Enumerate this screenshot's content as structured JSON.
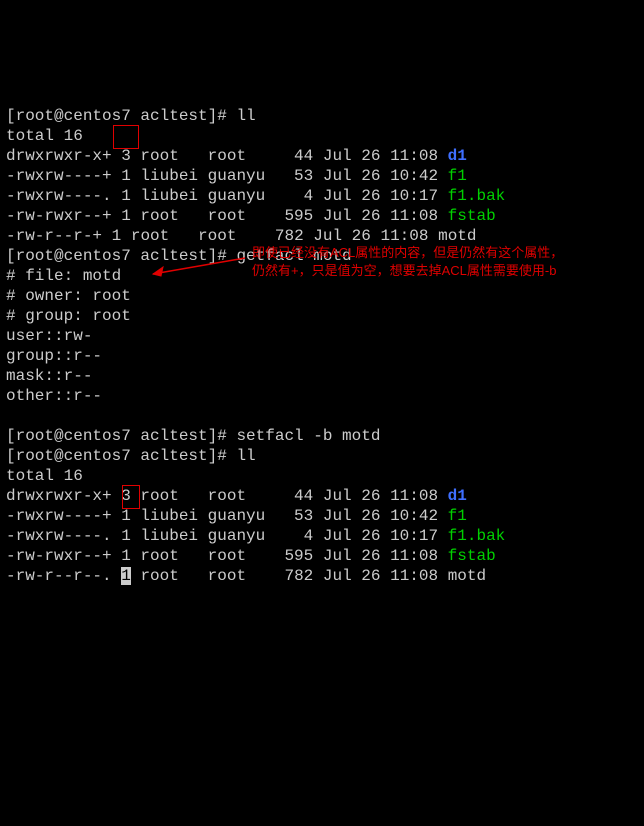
{
  "line1": "[root@centos7 acltest]# ll",
  "line2": "total 16",
  "r1_perm": "drwxrwxr-x+ 3 root   root     44 Jul 26 11:08 ",
  "r1_name": "d1",
  "r2_perm": "-rwxrw----+ 1 liubei guanyu   53 Jul 26 10:42 ",
  "r2_name": "f1",
  "r3_perm": "-rwxrw----. 1 liubei guanyu    4 Jul 26 10:17 ",
  "r3_name": "f1.bak",
  "r4_perm": "-rw-rwxr--+ 1 root   root    595 Jul 26 11:08 ",
  "r4_name": "fstab",
  "r5a": "-rw-r--r-",
  "r5b": "+",
  "r5c": " 1 root   root    782 Jul 26 11:08 motd",
  "line8": "[root@centos7 acltest]# getfacl motd",
  "line9": "# file: motd",
  "line10": "# owner: root",
  "line11": "# group: root",
  "line12": "user::rw-",
  "line13": "group::r--",
  "line14": "mask::r--",
  "line15": "other::r--",
  "blank": "",
  "line17": "[root@centos7 acltest]# setfacl -b motd",
  "line18": "[root@centos7 acltest]# ll",
  "line19": "total 16",
  "s1_perm": "drwxrwxr-x+ 3 root   root     44 Jul 26 11:08 ",
  "s1_name": "d1",
  "s2_perm": "-rwxrw----+ 1 liubei guanyu   53 Jul 26 10:42 ",
  "s2_name": "f1",
  "s3_perm": "-rwxrw----. 1 liubei guanyu    4 Jul 26 10:17 ",
  "s3_name": "f1.bak",
  "s4_perm": "-rw-rwxr--+ 1 root   root    595 Jul 26 11:08 ",
  "s4_name": "fstab",
  "s5a": "-rw-r--r--",
  "s5b": ".",
  "s5c": " ",
  "s5d": "1",
  "s5e": " root   root    782 Jul 26 11:08 motd",
  "ann1": "即使已经没有ACL属性的内容，但是仍然有这个属性，",
  "ann2": "仍然有+，只是值为空，想要去掉ACL属性需要使用-b"
}
